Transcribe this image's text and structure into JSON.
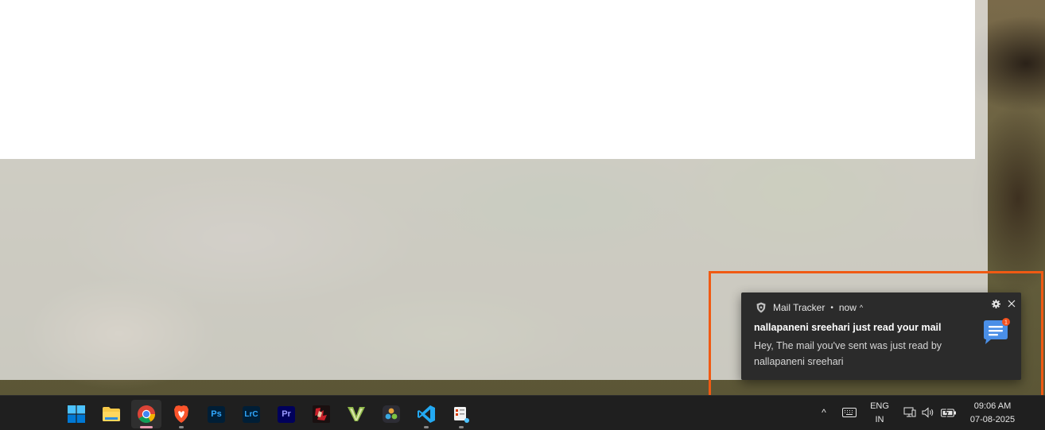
{
  "notification": {
    "app_name": "Mail Tracker",
    "separator": "•",
    "time": "now",
    "chevron": "^",
    "settings_icon": "gear-icon",
    "close_icon": "close-icon",
    "title": "nallapaneni sreehari just read your mail",
    "body": "Hey, The mail you've sent was just read by nallapaneni sreehari",
    "image_icon": "chat-message-icon",
    "badge_count": "1",
    "highlight_color": "#f05a13"
  },
  "taskbar": {
    "apps": [
      {
        "name": "Start",
        "icon": "windows-start-icon"
      },
      {
        "name": "File Explorer",
        "icon": "folder-icon"
      },
      {
        "name": "Google Chrome",
        "icon": "chrome-icon"
      },
      {
        "name": "Brave",
        "icon": "brave-lion-icon"
      },
      {
        "name": "Photoshop",
        "label": "Ps",
        "color": "#31a8ff",
        "bg": "#001e36"
      },
      {
        "name": "Lightroom Classic",
        "label": "LrC",
        "color": "#31a8ff",
        "bg": "#001e36"
      },
      {
        "name": "Premiere Pro",
        "label": "Pr",
        "color": "#9999ff",
        "bg": "#00005b"
      },
      {
        "name": "Game",
        "icon": "game-icon"
      },
      {
        "name": "Vectorworks",
        "icon": "v-logo-icon"
      },
      {
        "name": "DaVinci Resolve",
        "icon": "davinci-icon"
      },
      {
        "name": "Visual Studio Code",
        "icon": "vscode-icon"
      },
      {
        "name": "Snipping Tool",
        "icon": "snip-icon"
      }
    ],
    "tray": {
      "chevron": "^",
      "keyboard_icon": "keyboard-icon",
      "lang_top": "ENG",
      "lang_bottom": "IN",
      "network_icon": "network-icon",
      "volume_icon": "volume-icon",
      "battery_icon": "battery-icon",
      "time": "09:06 AM",
      "date": "07-08-2025"
    }
  }
}
